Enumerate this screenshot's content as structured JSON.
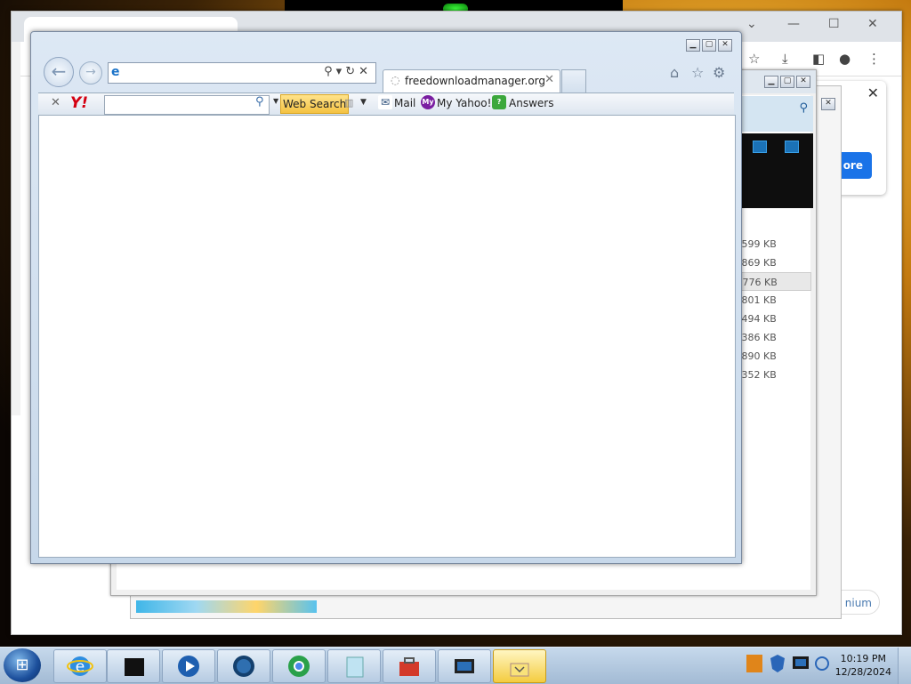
{
  "ie": {
    "tab_title": "freedownloadmanager.org",
    "address_value": "",
    "toolbar": {
      "web_search_label": "Web Search",
      "yahoo_logo": "Y!",
      "mail_label": "Mail",
      "my_yahoo_label": "My Yahoo!",
      "answers_label": "Answers"
    }
  },
  "fdm": {
    "file_sizes": [
      ",599 KB",
      ",869 KB",
      ",776 KB",
      ",801 KB",
      ",494 KB",
      ",386 KB",
      ",890 KB",
      ",352 KB"
    ]
  },
  "chrome": {
    "popup_button_label": "ore",
    "premium_label": "nium"
  },
  "taskbar": {
    "time": "10:19 PM",
    "date": "12/28/2024"
  },
  "colors": {
    "ie_frame": "#c7d8ea",
    "taskbar": "#b6cbe2",
    "websearch": "#f4c242",
    "chrome_button": "#1a73e8"
  }
}
